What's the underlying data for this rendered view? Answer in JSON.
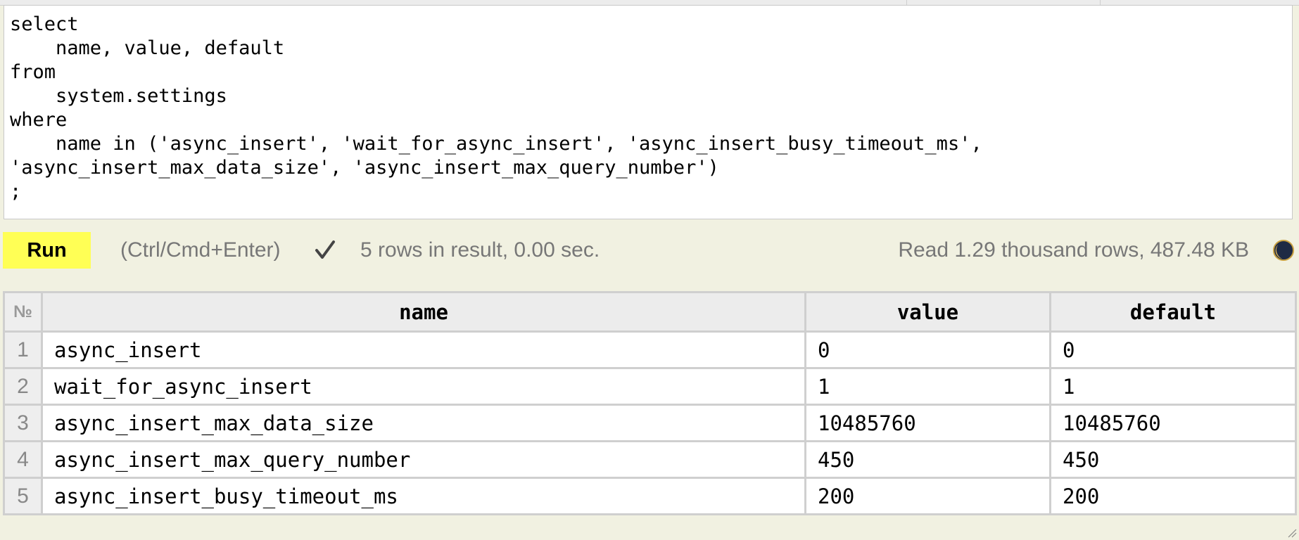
{
  "editor": {
    "query": "select\n    name, value, default\nfrom\n    system.settings\nwhere\n    name in ('async_insert', 'wait_for_async_insert', 'async_insert_busy_timeout_ms',\n'async_insert_max_data_size', 'async_insert_max_query_number')\n;"
  },
  "toolbar": {
    "run_label": "Run",
    "hint": "(Ctrl/Cmd+Enter)",
    "status_icon": "check-icon",
    "result_summary": "5 rows in result, 0.00 sec.",
    "read_stats": "Read 1.29 thousand rows, 487.48 KB",
    "theme_icon": "moon-icon"
  },
  "results": {
    "rownum_header": "№",
    "columns": [
      "name",
      "value",
      "default"
    ],
    "rows": [
      {
        "num": "1",
        "name": "async_insert",
        "value": "0",
        "default": "0"
      },
      {
        "num": "2",
        "name": "wait_for_async_insert",
        "value": "1",
        "default": "1"
      },
      {
        "num": "3",
        "name": "async_insert_max_data_size",
        "value": "10485760",
        "default": "10485760"
      },
      {
        "num": "4",
        "name": "async_insert_max_query_number",
        "value": "450",
        "default": "450"
      },
      {
        "num": "5",
        "name": "async_insert_busy_timeout_ms",
        "value": "200",
        "default": "200"
      }
    ]
  },
  "colors": {
    "background": "#f1f1e1",
    "run_button": "#ffff55",
    "muted_text": "#777777",
    "grid": "#cfcfcf"
  }
}
